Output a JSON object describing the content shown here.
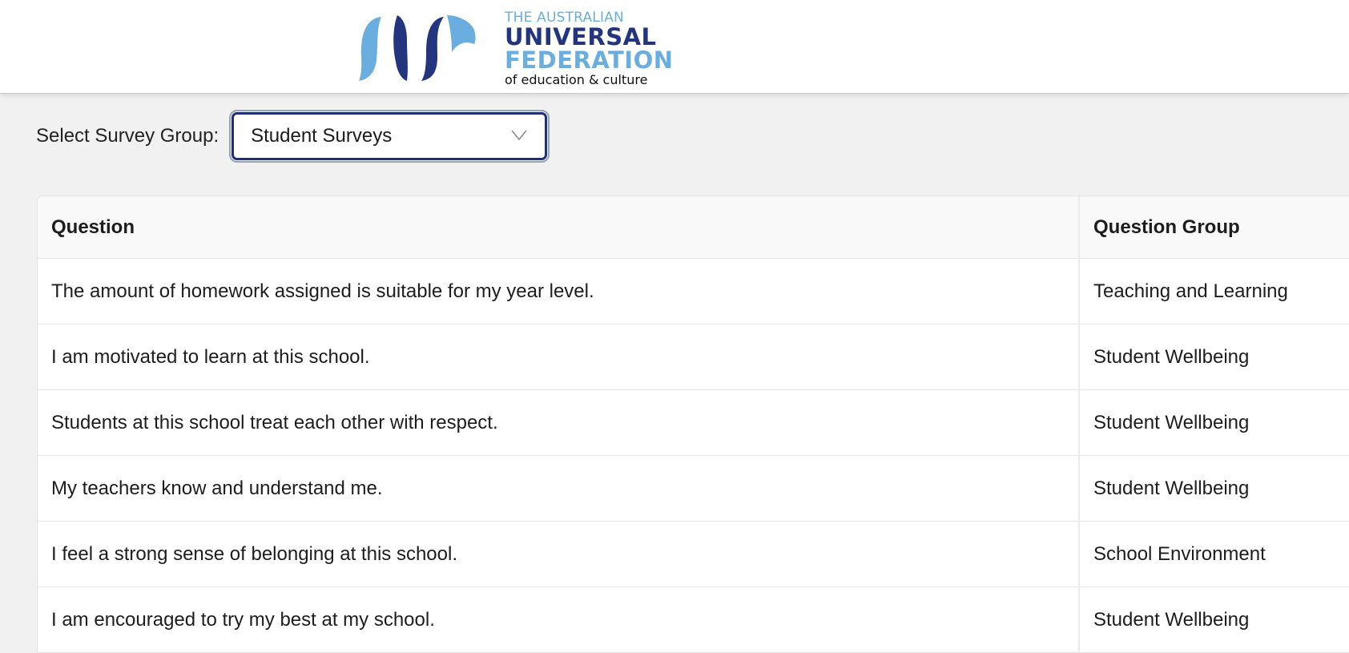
{
  "header": {
    "logo": {
      "line1": "THE AUSTRALIAN",
      "line2": "UNIVERSAL",
      "line3": "FEDERATION",
      "line4": "of education & culture",
      "colors": {
        "dark_blue": "#22357e",
        "light_blue": "#6aaee0"
      }
    }
  },
  "filter": {
    "label": "Select Survey Group:",
    "selected": "Student Surveys",
    "icon": "chevron-down-icon"
  },
  "table": {
    "columns": [
      "Question",
      "Question Group"
    ],
    "rows": [
      {
        "question": "The amount of homework assigned is suitable for my year level.",
        "group": "Teaching and Learning"
      },
      {
        "question": "I am motivated to learn at this school.",
        "group": "Student Wellbeing"
      },
      {
        "question": "Students at this school treat each other with respect.",
        "group": "Student Wellbeing"
      },
      {
        "question": "My teachers know and understand me.",
        "group": "Student Wellbeing"
      },
      {
        "question": "I feel a strong sense of belonging at this school.",
        "group": "School Environment"
      },
      {
        "question": "I am encouraged to try my best at my school.",
        "group": "Student Wellbeing"
      }
    ]
  }
}
